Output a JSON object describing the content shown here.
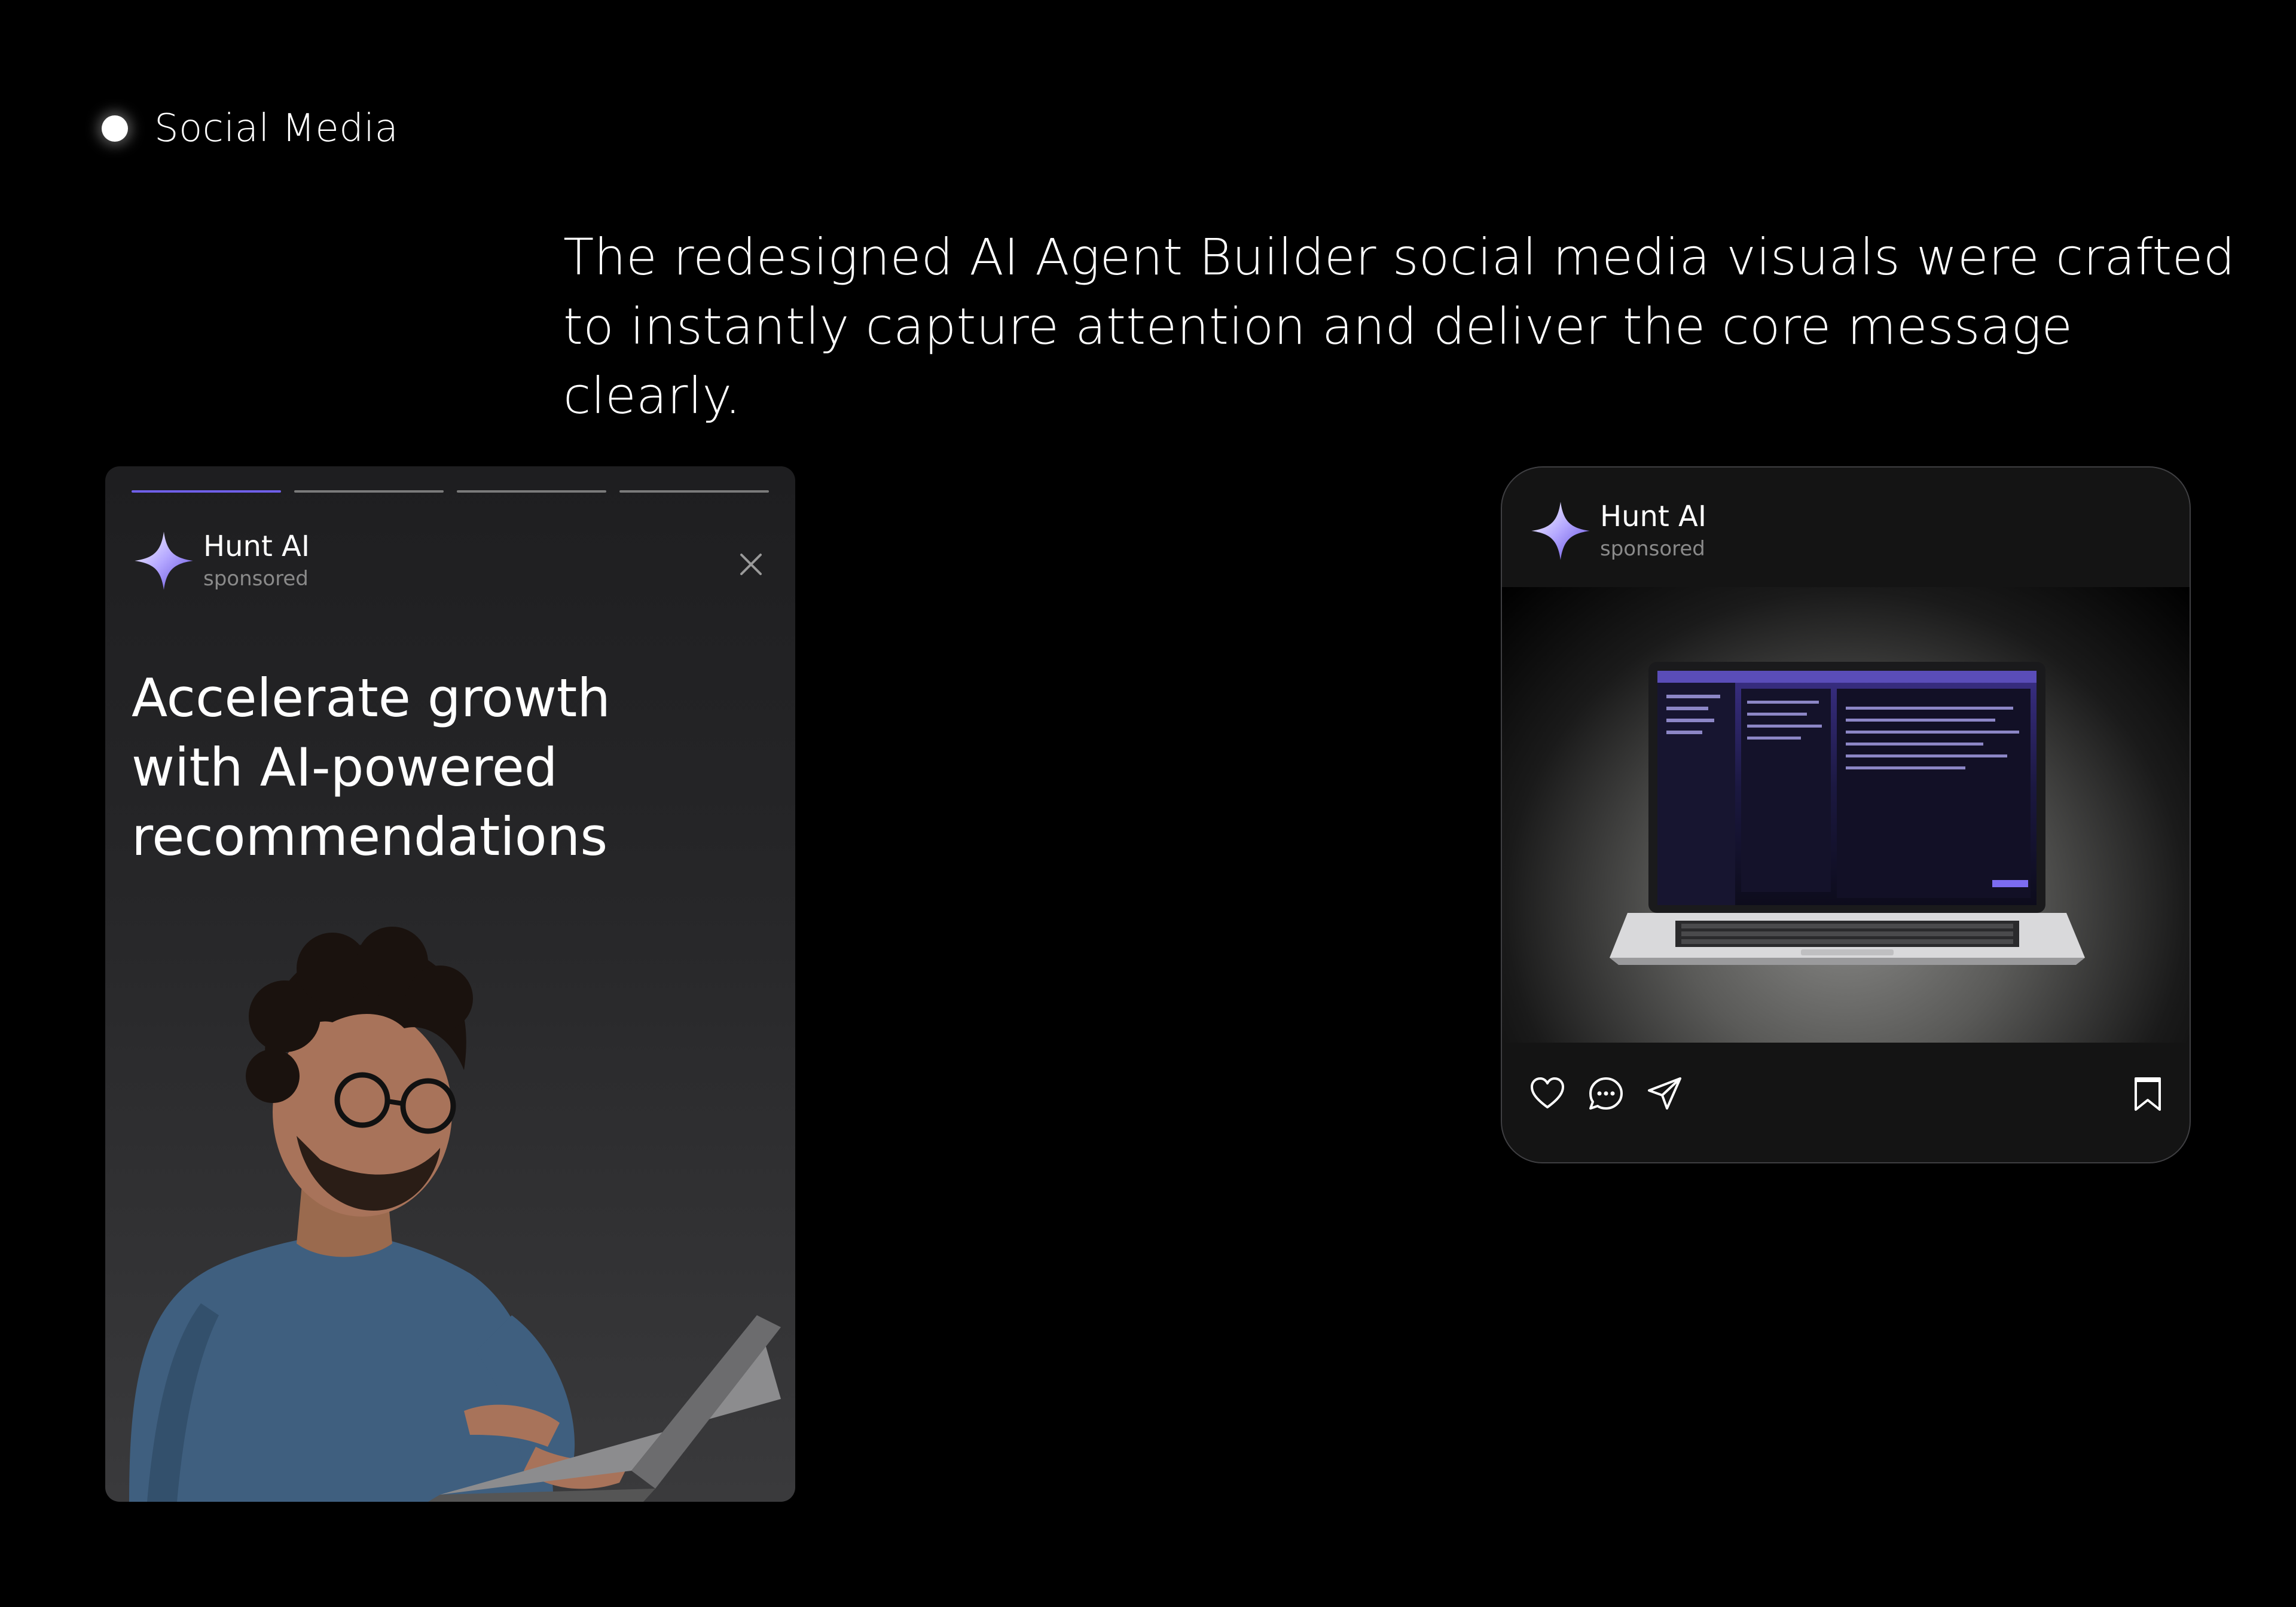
{
  "section": {
    "label": "Social Media"
  },
  "headline": "The redesigned AI Agent Builder social media visuals were crafted to instantly capture attention and deliver the core message clearly.",
  "story": {
    "brand_name": "Hunt AI",
    "brand_sub": "sponsored",
    "title": "Accelerate growth with AI-powered recommendations",
    "progress_segments": 4,
    "active_segment": 1
  },
  "post": {
    "brand_name": "Hunt AI",
    "brand_sub": "sponsored",
    "actions": [
      "heart-icon",
      "comment-icon",
      "share-icon",
      "bookmark-icon"
    ]
  },
  "colors": {
    "background": "#000000",
    "accent": "#6f5fe8",
    "card": "#1e1e20"
  }
}
